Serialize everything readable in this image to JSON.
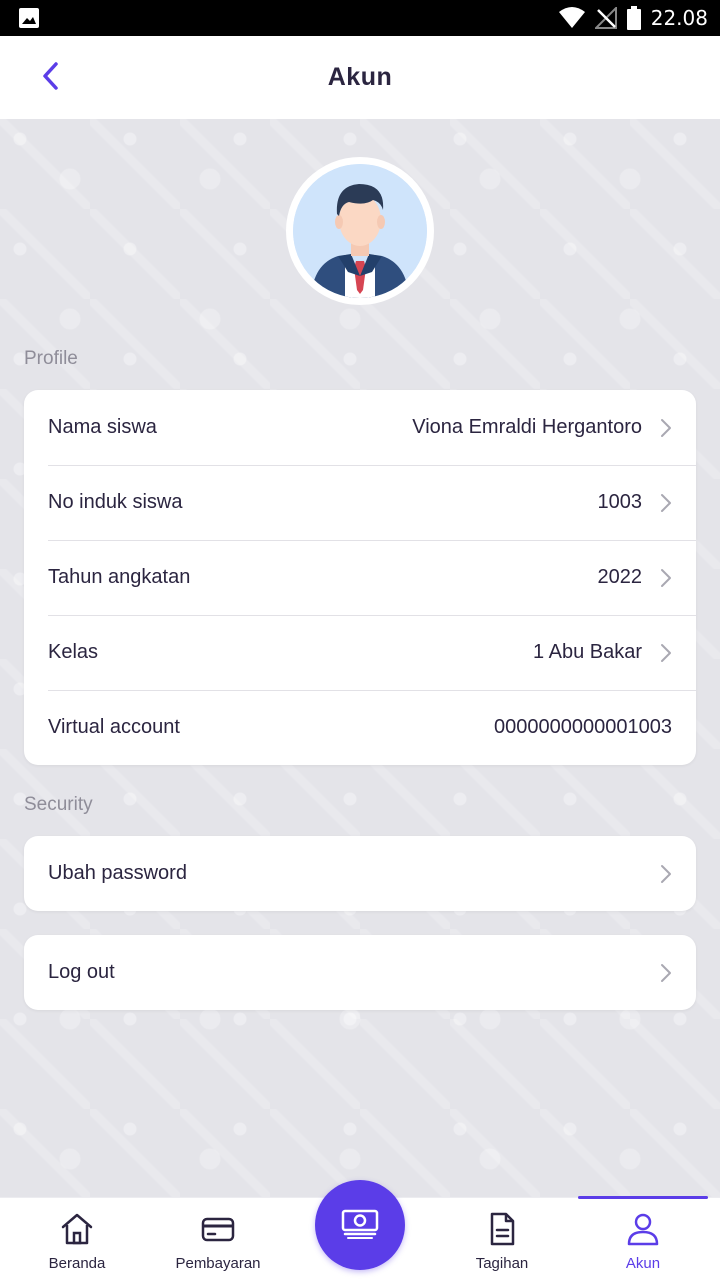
{
  "status_bar": {
    "time": "22.08",
    "icons": [
      "image-icon",
      "wifi-icon",
      "no-signal-icon",
      "battery-icon"
    ]
  },
  "header": {
    "title": "Akun",
    "back_icon": "chevron-left-icon"
  },
  "colors": {
    "accent": "#5b3de8",
    "text": "#2b2540",
    "muted": "#8f8d99",
    "background": "#e4e4e9"
  },
  "profile": {
    "section_label": "Profile",
    "rows": [
      {
        "label": "Nama siswa",
        "value": "Viona Emraldi Hergantoro"
      },
      {
        "label": "No induk siswa",
        "value": "1003"
      },
      {
        "label": "Tahun angkatan",
        "value": "2022"
      },
      {
        "label": "Kelas",
        "value": "1 Abu Bakar"
      },
      {
        "label": "Virtual account",
        "value": "0000000000001003"
      }
    ]
  },
  "security": {
    "section_label": "Security",
    "change_password": "Ubah password",
    "logout": "Log out"
  },
  "bottom_nav": {
    "items": [
      {
        "label": "Beranda",
        "icon": "home-icon"
      },
      {
        "label": "Pembayaran",
        "icon": "card-icon"
      },
      {
        "label": "Tagihan",
        "icon": "document-icon"
      },
      {
        "label": "Akun",
        "icon": "user-icon"
      }
    ],
    "fab_icon": "money-icon",
    "active": "Akun"
  }
}
